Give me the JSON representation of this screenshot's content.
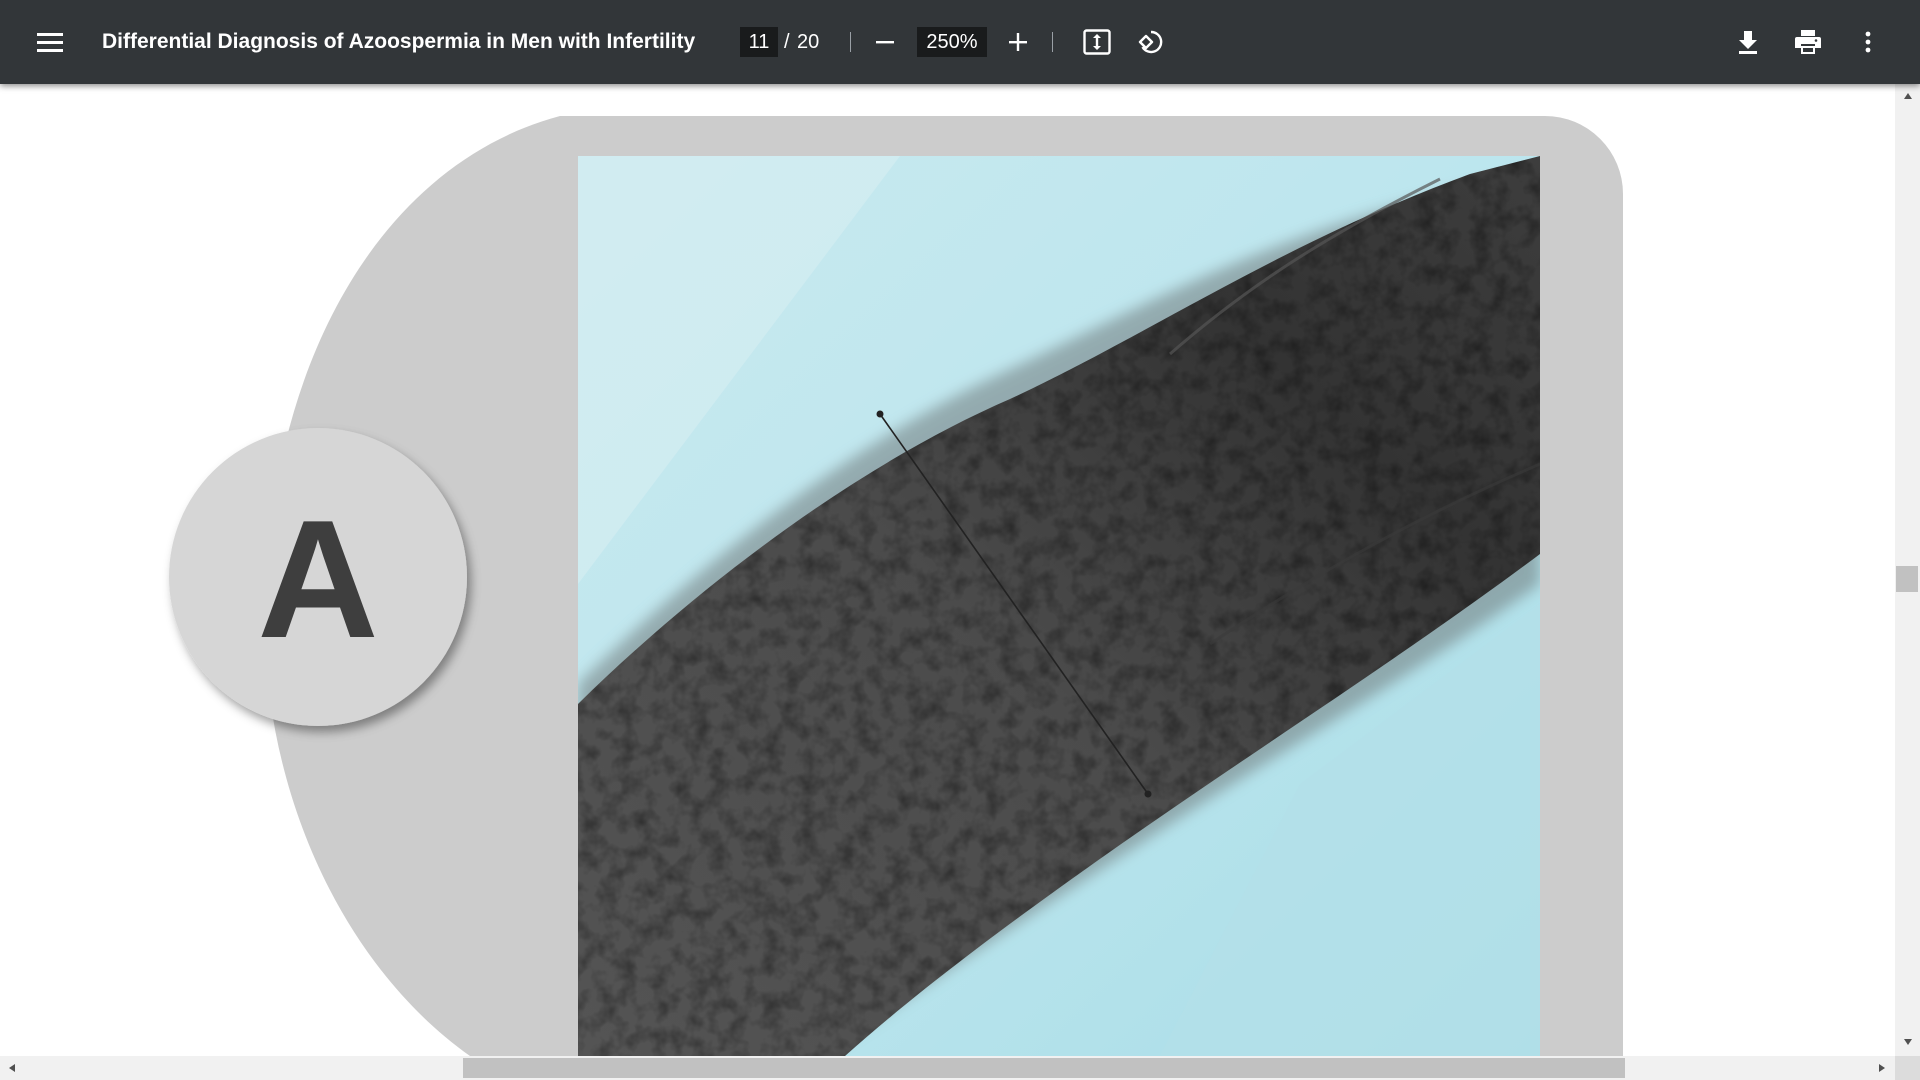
{
  "toolbar": {
    "title": "Differential Diagnosis of Azoospermia in Men with Infertility",
    "current_page": "11",
    "page_separator": "/",
    "total_pages": "20",
    "zoom": "250%"
  },
  "figure": {
    "panel_label": "A"
  },
  "colors": {
    "toolbar_bg": "#323639",
    "panel_bg": "#cccccc",
    "label_circle": "#d6d6d6",
    "label_text": "#3e3e3e"
  }
}
